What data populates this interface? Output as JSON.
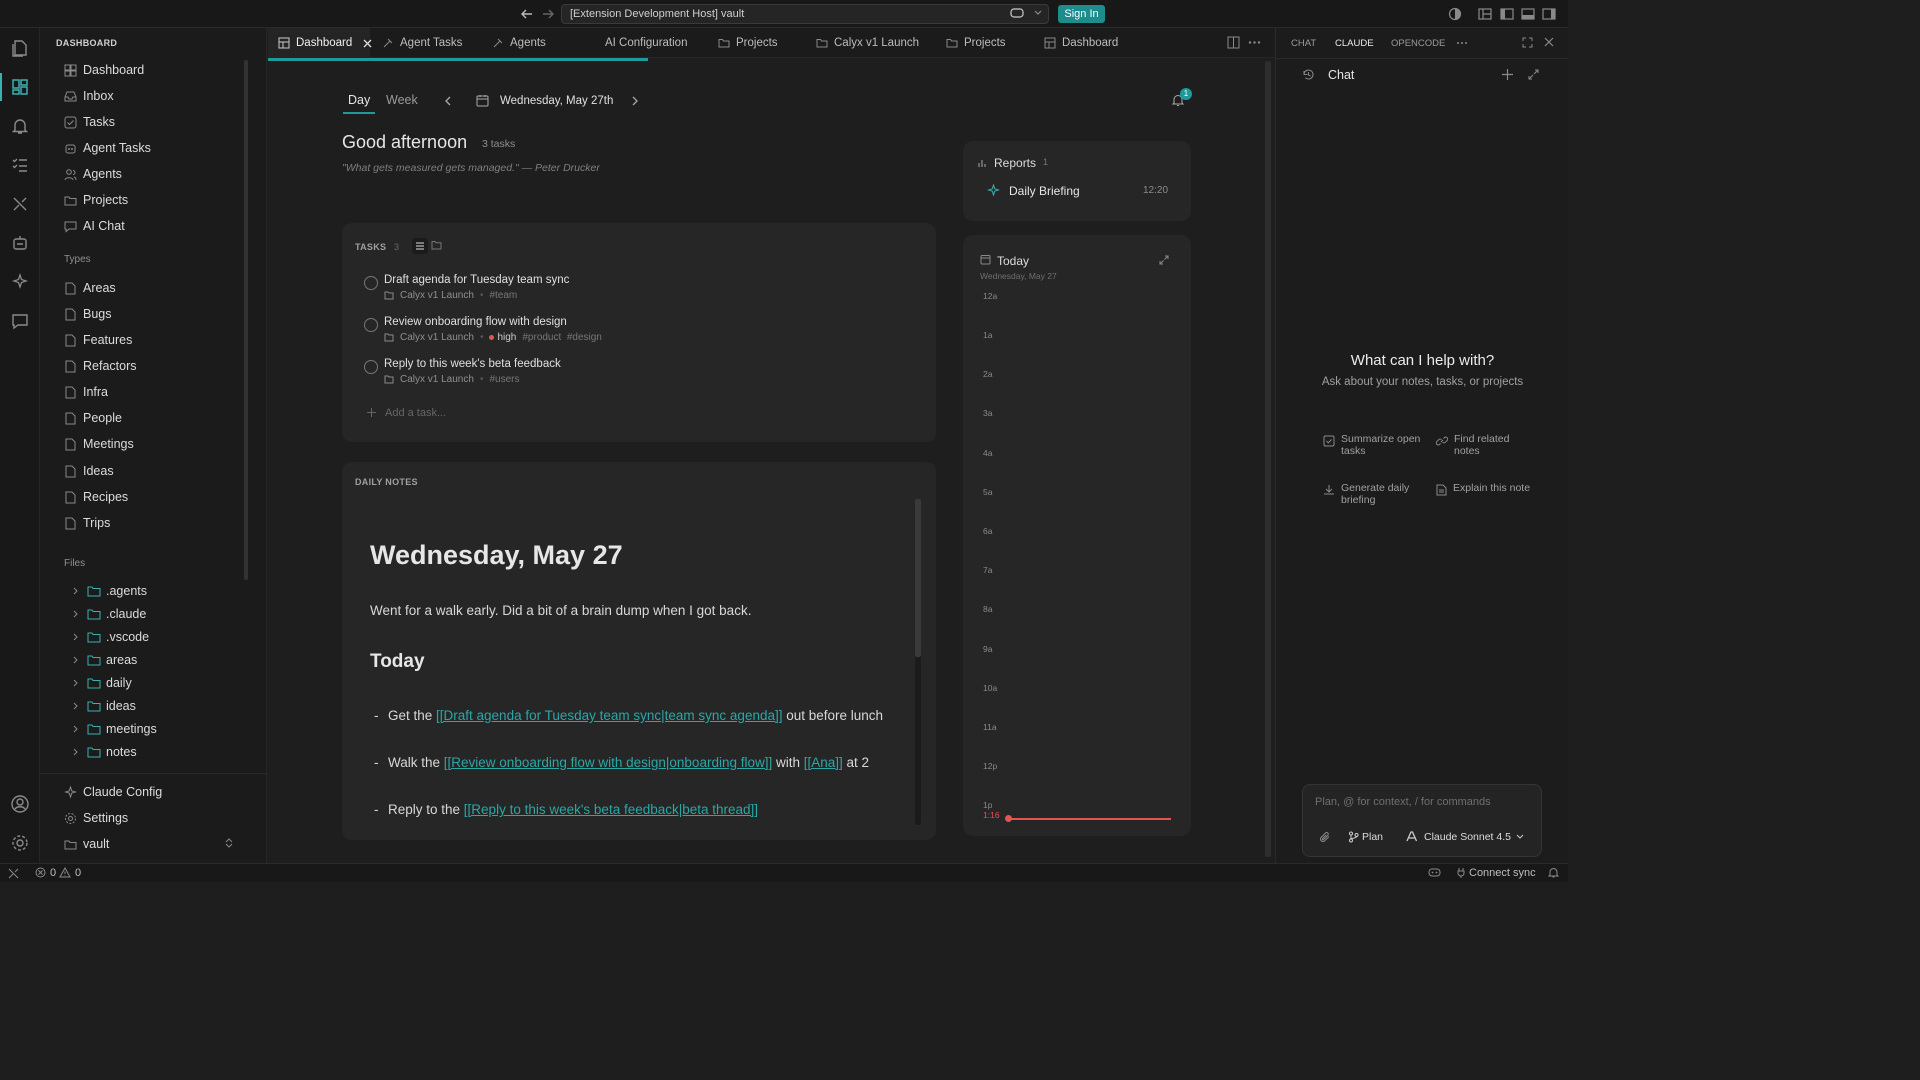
{
  "window": {
    "address": "[Extension Development Host] vault",
    "sign_in": "Sign In"
  },
  "sidebar": {
    "header": "DASHBOARD",
    "nav": [
      {
        "label": "Dashboard",
        "icon": "dashboard-icon"
      },
      {
        "label": "Inbox",
        "icon": "inbox-icon"
      },
      {
        "label": "Tasks",
        "icon": "checkbox-icon"
      },
      {
        "label": "Agent Tasks",
        "icon": "agent-icon"
      },
      {
        "label": "Agents",
        "icon": "people-icon"
      },
      {
        "label": "Projects",
        "icon": "folder-icon"
      },
      {
        "label": "AI Chat",
        "icon": "chat-icon"
      }
    ],
    "types_label": "Types",
    "types": [
      "Areas",
      "Bugs",
      "Features",
      "Refactors",
      "Infra",
      "People",
      "Meetings",
      "Ideas",
      "Recipes",
      "Trips"
    ],
    "files_label": "Files",
    "files": [
      ".agents",
      ".claude",
      ".vscode",
      "areas",
      "daily",
      "ideas",
      "meetings",
      "notes"
    ],
    "bottom": [
      {
        "label": "Claude Config",
        "icon": "sparkle-icon"
      },
      {
        "label": "Settings",
        "icon": "gear-icon"
      },
      {
        "label": "vault",
        "icon": "folder-icon"
      }
    ]
  },
  "tabs": [
    {
      "label": "Dashboard",
      "icon": "dashboard-icon",
      "active": true
    },
    {
      "label": "Agent Tasks",
      "icon": "agent-icon"
    },
    {
      "label": "Agents",
      "icon": "agent-icon"
    },
    {
      "label": "AI Configuration",
      "icon": ""
    },
    {
      "label": "Projects",
      "icon": "folder-icon"
    },
    {
      "label": "Calyx v1 Launch",
      "icon": "folder-icon"
    },
    {
      "label": "Projects",
      "icon": "folder-icon"
    },
    {
      "label": "Dashboard",
      "icon": "dashboard-icon"
    }
  ],
  "dashboard": {
    "view_day": "Day",
    "view_week": "Week",
    "date": "Wednesday, May 27th",
    "notification_count": "1",
    "greeting": "Good afternoon",
    "task_count_label": "3 tasks",
    "quote": "\"What gets measured gets managed.\" — Peter Drucker",
    "tasks_header": "TASKS",
    "tasks_count": "3",
    "tasks": [
      {
        "title": "Draft agenda for Tuesday team sync",
        "project": "Calyx v1 Launch",
        "priority": "",
        "tags": "#team"
      },
      {
        "title": "Review onboarding flow with design",
        "project": "Calyx v1 Launch",
        "priority": "high",
        "tags": "#product  #design"
      },
      {
        "title": "Reply to this week's beta feedback",
        "project": "Calyx v1 Launch",
        "priority": "",
        "tags": "#users"
      }
    ],
    "add_task_placeholder": "Add a task...",
    "daily_notes_header": "DAILY NOTES",
    "note": {
      "title": "Wednesday, May 27",
      "intro": "Went for a walk early. Did a bit of a brain dump when I got back.",
      "section": "Today",
      "b1_pre": "Get the ",
      "b1_link": "[[Draft agenda for Tuesday team sync|team sync agenda]]",
      "b1_post": " out before lunch",
      "b2_pre": "Walk the ",
      "b2_link": "[[Review onboarding flow with design|onboarding flow]]",
      "b2_mid": " with ",
      "b2_link2": "[[Ana]]",
      "b2_post": " at 2",
      "b3_pre": "Reply to the ",
      "b3_link": "[[Reply to this week's beta feedback|beta thread]]"
    },
    "reports_label": "Reports",
    "reports_count": "1",
    "report_item": "Daily Briefing",
    "report_time": "12:20",
    "today_label": "Today",
    "today_date": "Wednesday, May 27",
    "hours": [
      "12a",
      "1a",
      "2a",
      "3a",
      "4a",
      "5a",
      "6a",
      "7a",
      "8a",
      "9a",
      "10a",
      "11a",
      "12p",
      "1p"
    ],
    "now_time": "1:16",
    "now_color": "#e25555"
  },
  "right_panel": {
    "tabs": [
      "CHAT",
      "CLAUDE",
      "OPENCODE"
    ],
    "active_tab": "CLAUDE",
    "title": "Chat",
    "prompt_title": "What can I help with?",
    "prompt_sub": "Ask about your notes, tasks, or projects",
    "suggestions": [
      {
        "label": "Summarize open tasks",
        "icon": "checkbox-icon"
      },
      {
        "label": "Find related notes",
        "icon": "link-icon"
      },
      {
        "label": "Generate daily briefing",
        "icon": "briefing-icon"
      },
      {
        "label": "Explain this note",
        "icon": "document-icon"
      }
    ],
    "input_placeholder": "Plan, @ for context, / for commands",
    "plan_label": "Plan",
    "model": "Claude Sonnet 4.5"
  },
  "status": {
    "errors": "0",
    "warnings": "0",
    "connect": "Connect sync"
  },
  "colors": {
    "accent": "#1f9a9a",
    "link": "#2aa7a7",
    "priority_high": "#e25555"
  }
}
